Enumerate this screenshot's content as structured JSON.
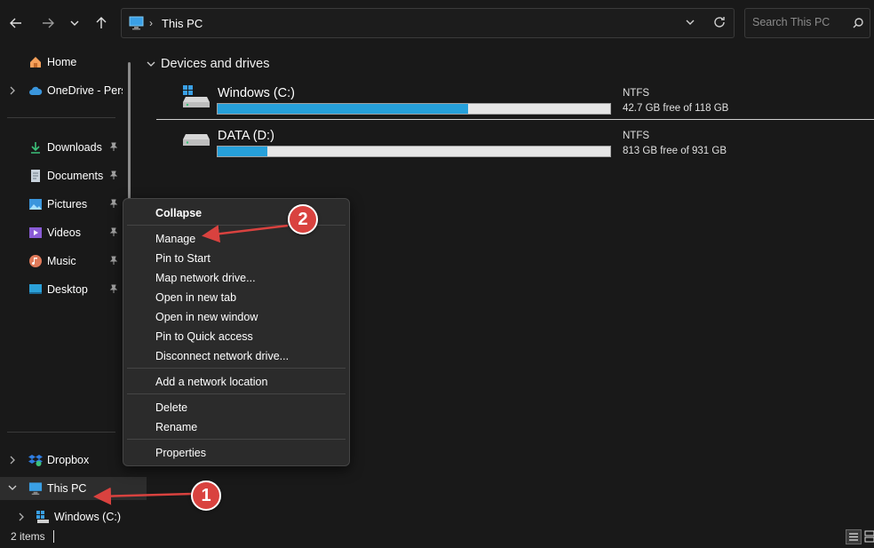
{
  "address": {
    "breadcrumb": "This PC",
    "search_placeholder": "Search This PC"
  },
  "sidebar": {
    "home": "Home",
    "onedrive": "OneDrive - Perso",
    "pinned": [
      {
        "label": "Downloads"
      },
      {
        "label": "Documents"
      },
      {
        "label": "Pictures"
      },
      {
        "label": "Videos"
      },
      {
        "label": "Music"
      },
      {
        "label": "Desktop"
      }
    ],
    "dropbox": "Dropbox",
    "this_pc": "This PC",
    "windows_c": "Windows (C:)"
  },
  "main": {
    "section_title": "Devices and drives",
    "drives": [
      {
        "name": "Windows (C:)",
        "fs": "NTFS",
        "free_text": "42.7 GB free of 118 GB",
        "used_fraction": 0.638
      },
      {
        "name": "DATA (D:)",
        "fs": "NTFS",
        "free_text": "813 GB free of 931 GB",
        "used_fraction": 0.127
      }
    ]
  },
  "context_menu": {
    "collapse": "Collapse",
    "manage": "Manage",
    "pin_start": "Pin to Start",
    "map_drive": "Map network drive...",
    "open_tab": "Open in new tab",
    "open_window": "Open in new window",
    "pin_quick": "Pin to Quick access",
    "disconnect": "Disconnect network drive...",
    "add_location": "Add a network location",
    "delete": "Delete",
    "rename": "Rename",
    "properties": "Properties"
  },
  "annotations": {
    "step1": "1",
    "step2": "2"
  },
  "status": {
    "item_count": "2 items"
  },
  "colors": {
    "accent": "#26a0da",
    "badge": "#d9423f",
    "background": "#191919",
    "menu": "#2b2b2b"
  }
}
